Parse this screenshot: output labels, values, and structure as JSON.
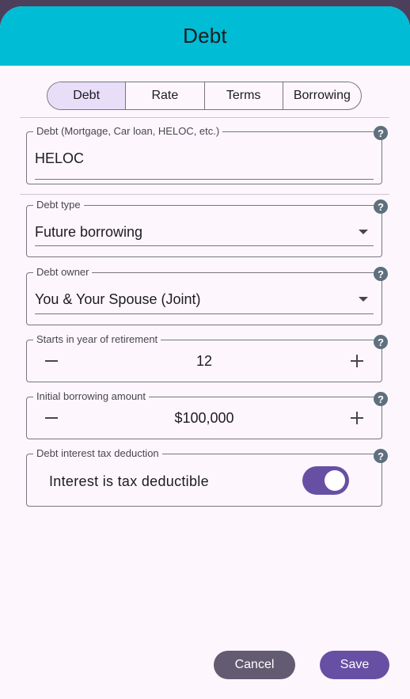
{
  "dialog": {
    "title": "Debt"
  },
  "tabs": [
    {
      "label": "Debt",
      "selected": true
    },
    {
      "label": "Rate",
      "selected": false
    },
    {
      "label": "Terms",
      "selected": false
    },
    {
      "label": "Borrowing",
      "selected": false
    }
  ],
  "fields": {
    "debt_name": {
      "label": "Debt (Mortgage, Car loan, HELOC, etc.)",
      "value": "HELOC"
    },
    "debt_type": {
      "label": "Debt type",
      "value": "Future borrowing"
    },
    "debt_owner": {
      "label": "Debt owner",
      "value": "You & Your Spouse (Joint)"
    },
    "start_year": {
      "label": "Starts in year of retirement",
      "value": "12"
    },
    "initial_amount": {
      "label": "Initial borrowing amount",
      "value": "$100,000"
    },
    "tax_deduction": {
      "label": "Debt interest tax deduction",
      "toggle_label": "Interest is tax deductible",
      "enabled": true
    }
  },
  "help_icon": "?",
  "buttons": {
    "cancel": "Cancel",
    "save": "Save"
  },
  "colors": {
    "header": "#00bcd4",
    "accent": "#6750a4",
    "secondary": "#625b71",
    "selected_segment": "#e8def8",
    "help_icon": "#5f6f7d"
  }
}
